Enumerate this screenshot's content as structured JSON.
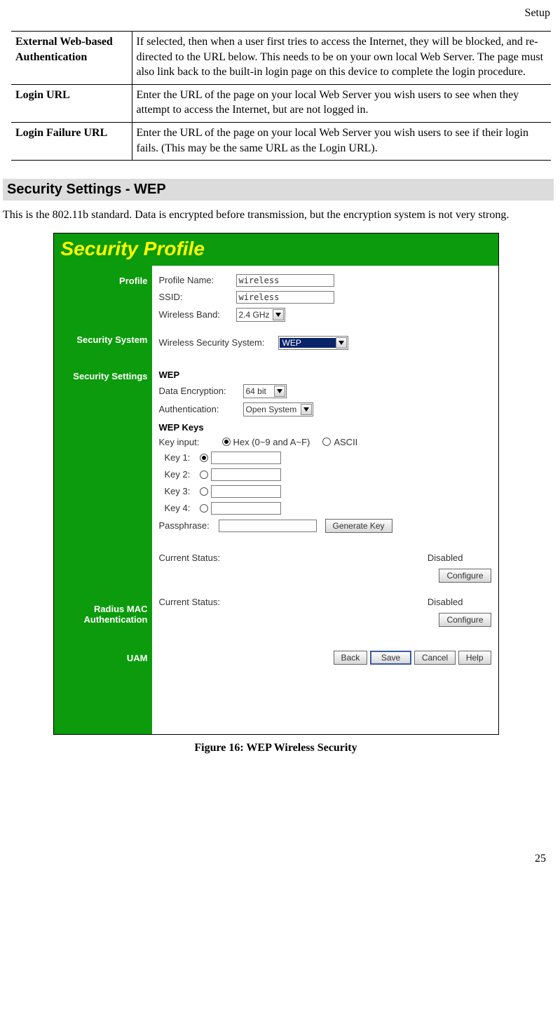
{
  "header_right": "Setup",
  "table": [
    {
      "term": "External Web-based Authentication",
      "desc": "If selected, then when a user first tries to access the Internet, they will be blocked, and re-directed to the URL below. This needs to be on your own local Web Server. The page must also link back to the built-in login page on this device to complete the login procedure."
    },
    {
      "term": "Login URL",
      "desc": "Enter the URL of the page on your local Web Server you wish users to see when they attempt to access the Internet, but are not logged in."
    },
    {
      "term": "Login Failure URL",
      "desc": "Enter the URL of the page on your local Web Server you wish users to see if their login fails. (This may be the same URL as the Login URL)."
    }
  ],
  "section_title": "Security Settings - WEP",
  "section_body": "This is the 802.11b standard. Data is encrypted before transmission, but the encryption system is not very strong.",
  "fig": {
    "title": "Security Profile",
    "side": {
      "profile": "Profile",
      "secsys": "Security System",
      "secset": "Security Settings",
      "radius": "Radius MAC Authentication",
      "uam": "UAM"
    },
    "profile": {
      "name_label": "Profile Name:",
      "name_value": "wireless",
      "ssid_label": "SSID:",
      "ssid_value": "wireless",
      "band_label": "Wireless Band:",
      "band_value": "2.4 GHz"
    },
    "secsys": {
      "label": "Wireless Security System:",
      "value": "WEP"
    },
    "wep": {
      "heading": "WEP",
      "enc_label": "Data Encryption:",
      "enc_value": "64 bit",
      "auth_label": "Authentication:",
      "auth_value": "Open System",
      "keys_heading": "WEP Keys",
      "keyinput_label": "Key input:",
      "hex_label": "Hex (0~9 and A~F)",
      "ascii_label": "ASCII",
      "k1": "Key 1:",
      "k2": "Key 2:",
      "k3": "Key 3:",
      "k4": "Key 4:",
      "pass_label": "Passphrase:",
      "gen_btn": "Generate Key"
    },
    "radius": {
      "status_label": "Current Status:",
      "status_value": "Disabled",
      "btn": "Configure"
    },
    "uam": {
      "status_label": "Current Status:",
      "status_value": "Disabled",
      "btn": "Configure"
    },
    "buttons": {
      "back": "Back",
      "save": "Save",
      "cancel": "Cancel",
      "help": "Help"
    }
  },
  "caption": "Figure 16: WEP Wireless Security",
  "page_number": "25"
}
